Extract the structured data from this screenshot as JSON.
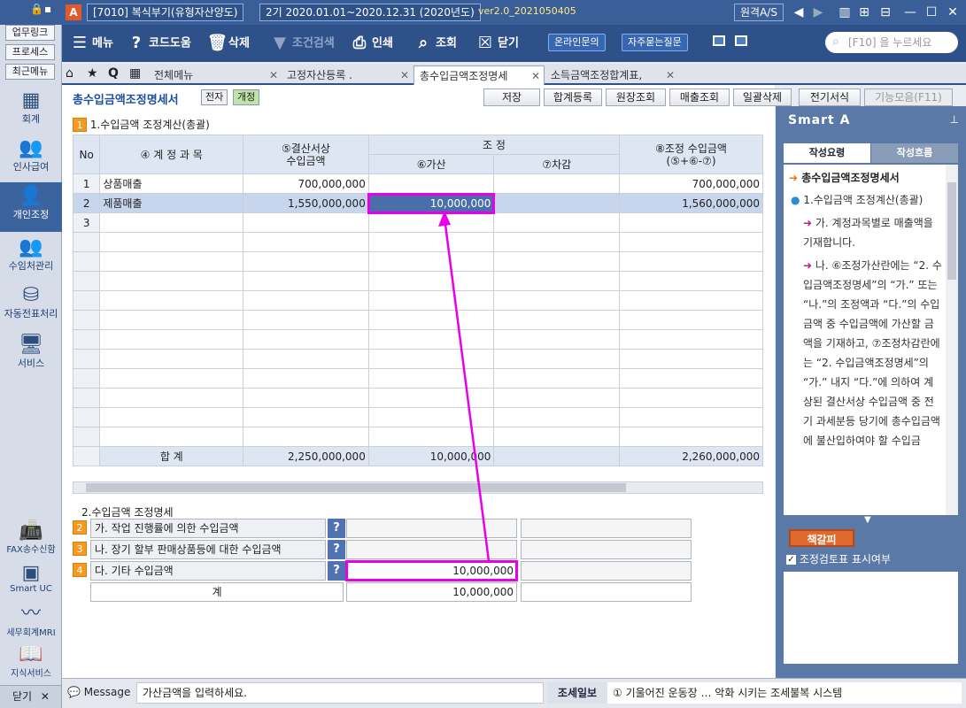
{
  "titlebar": {
    "app_code": "[7010] 복식부기(유형자산양도)",
    "period": "2기  2020.01.01~2020.12.31  (2020년도)",
    "version": "ver2.0_2021050405",
    "remote_as": "원격A/S"
  },
  "toolbar": {
    "menu": "메뉴",
    "code_help": "코드도움",
    "delete": "삭제",
    "condition_search": "조건검색",
    "print": "인쇄",
    "lookup": "조회",
    "close": "닫기",
    "online_inquiry": "온라인문의",
    "faq": "자주묻는질문",
    "search_placeholder": "[F10] 을 누르세요"
  },
  "sidebar": {
    "top_links": [
      "업무링크",
      "프로세스",
      "최근메뉴"
    ],
    "items": [
      {
        "label": "회계",
        "icon": "calculator-icon"
      },
      {
        "label": "인사급여",
        "icon": "people-icon"
      },
      {
        "label": "개인조정",
        "icon": "person-icon"
      },
      {
        "label": "수임처관리",
        "icon": "clients-icon"
      },
      {
        "label": "자동전표처리",
        "icon": "database-icon"
      },
      {
        "label": "서비스",
        "icon": "monitor-icon"
      }
    ],
    "bottom": [
      {
        "label": "FAX송수신함",
        "icon": "fax-icon"
      },
      {
        "label": "Smart UC",
        "icon": "uc-icon"
      },
      {
        "label": "세무회계MRI",
        "icon": "pulse-icon"
      },
      {
        "label": "지식서비스",
        "icon": "book-icon"
      }
    ],
    "close_label": "닫기"
  },
  "tabs": [
    {
      "label": "전체메뉴"
    },
    {
      "label": "고정자산등록 ."
    },
    {
      "label": "총수입금액조정명세"
    },
    {
      "label": "소득금액조정합계표,"
    }
  ],
  "main": {
    "title": "총수입금액조정명세서",
    "tag_doc": "전자",
    "tag_rev": "개정",
    "actions": [
      "저장",
      "합계등록",
      "원장조회",
      "매출조회",
      "일괄삭제",
      "전기서식",
      "기능모음(F11)"
    ],
    "section1": {
      "num": "1",
      "label": "1.수입금액 조정계산(총괄)"
    },
    "headers": {
      "no": "No",
      "account": "④ 계 정 과 목",
      "book": "⑤결산서상\n수입금액",
      "adjust": "조   정",
      "add": "⑥가산",
      "sub": "⑦차감",
      "adjusted": "⑧조정 수입금액\n(⑤+⑥-⑦)"
    },
    "rows": [
      {
        "no": "1",
        "account": "상품매출",
        "book": "700,000,000",
        "add": "",
        "sub": "",
        "adjusted": "700,000,000"
      },
      {
        "no": "2",
        "account": "제품매출",
        "book": "1,550,000,000",
        "add": "10,000,000",
        "sub": "",
        "adjusted": "1,560,000,000"
      },
      {
        "no": "3",
        "account": "",
        "book": "",
        "add": "",
        "sub": "",
        "adjusted": ""
      }
    ],
    "total": {
      "label": "합      계",
      "book": "2,250,000,000",
      "add": "10,000,000",
      "sub": "",
      "adjusted": "2,260,000,000"
    },
    "section2": {
      "label": "2.수입금액 조정명세"
    },
    "details": [
      {
        "num": "2",
        "label": "가. 작업 진행률에 의한 수입금액",
        "value": ""
      },
      {
        "num": "3",
        "label": "나. 장기 할부 판매상품등에 대한 수입금액",
        "value": ""
      },
      {
        "num": "4",
        "label": "다. 기타 수입금액",
        "value": "10,000,000"
      }
    ],
    "detail_total": {
      "label": "계",
      "value": "10,000,000"
    }
  },
  "right_panel": {
    "title": "Smart A",
    "tab1": "작성요령",
    "tab2": "작성흐름",
    "heading": "총수입금액조정명세서",
    "item1": "1.수입금액 조정계산(총괄)",
    "ga": "가. 계정과목별로 매출액을 기재합니다.",
    "na": "나. ⑥조정가산란에는 “2. 수입금액조정명세”의 “가.” 또는 “나.”의 조정액과 “다.”의 수입금액 중 수입금액에 가산할 금액을 기재하고, ⑦조정차감란에는 “2. 수입금액조정명세”의 “가.” 내지 “다.”에 의하여 계상된 결산서상 수입금액 중 전기 과세분등 당기에 총수입금액에 불산입하여야 할 수입금",
    "bookmark": "책갈피",
    "checkbox": "조정검토표 표시여부"
  },
  "status": {
    "message_label": "Message",
    "message": "가산금액을 입력하세요.",
    "news_label": "조세일보",
    "news": "① 기울어진 운동장 … 악화 시키는 조세불복 시스템"
  },
  "colors": {
    "accent": "#2f5189",
    "highlight": "#e800e8",
    "tag_orange": "#f39a22"
  }
}
